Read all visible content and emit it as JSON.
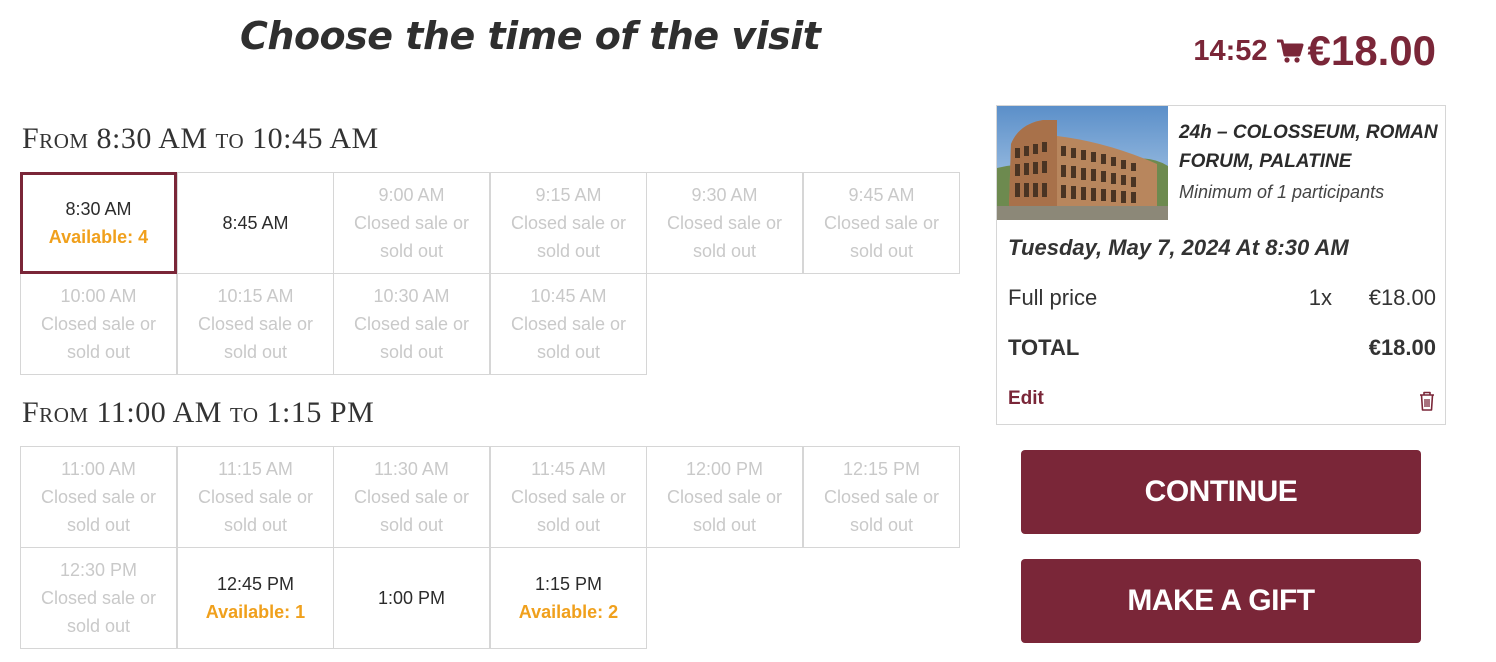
{
  "page_title": "Choose the time of the visit",
  "colors": {
    "accent": "#7a2638",
    "available": "#f0a01c",
    "closed": "#c9c9c9",
    "border": "#d6d6d6"
  },
  "header": {
    "timer": "14:52",
    "cart_icon": "shopping-cart-icon",
    "cart_total": "€18.00"
  },
  "sections": [
    {
      "title": "From 8:30 AM to 10:45 AM",
      "slots": [
        {
          "time": "8:30 AM",
          "status": "Available: 4",
          "state": "selected"
        },
        {
          "time": "8:45 AM",
          "status": "",
          "state": "open"
        },
        {
          "time": "9:00 AM",
          "status": "Closed sale or sold out",
          "state": "closed"
        },
        {
          "time": "9:15 AM",
          "status": "Closed sale or sold out",
          "state": "closed"
        },
        {
          "time": "9:30 AM",
          "status": "Closed sale or sold out",
          "state": "closed"
        },
        {
          "time": "9:45 AM",
          "status": "Closed sale or sold out",
          "state": "closed"
        },
        {
          "time": "10:00 AM",
          "status": "Closed sale or sold out",
          "state": "closed"
        },
        {
          "time": "10:15 AM",
          "status": "Closed sale or sold out",
          "state": "closed"
        },
        {
          "time": "10:30 AM",
          "status": "Closed sale or sold out",
          "state": "closed"
        },
        {
          "time": "10:45 AM",
          "status": "Closed sale or sold out",
          "state": "closed"
        }
      ]
    },
    {
      "title": "From 11:00 AM to 1:15 PM",
      "slots": [
        {
          "time": "11:00 AM",
          "status": "Closed sale or sold out",
          "state": "closed"
        },
        {
          "time": "11:15 AM",
          "status": "Closed sale or sold out",
          "state": "closed"
        },
        {
          "time": "11:30 AM",
          "status": "Closed sale or sold out",
          "state": "closed"
        },
        {
          "time": "11:45 AM",
          "status": "Closed sale or sold out",
          "state": "closed"
        },
        {
          "time": "12:00 PM",
          "status": "Closed sale or sold out",
          "state": "closed"
        },
        {
          "time": "12:15 PM",
          "status": "Closed sale or sold out",
          "state": "closed"
        },
        {
          "time": "12:30 PM",
          "status": "Closed sale or sold out",
          "state": "closed"
        },
        {
          "time": "12:45 PM",
          "status": "Available: 1",
          "state": "available"
        },
        {
          "time": "1:00 PM",
          "status": "",
          "state": "open"
        },
        {
          "time": "1:15 PM",
          "status": "Available: 2",
          "state": "available"
        }
      ]
    }
  ],
  "summary": {
    "product_name": "24h – COLOSSEUM, ROMAN FORUM, PALATINE",
    "minimum": "Minimum of 1 participants",
    "date": "Tuesday, May 7, 2024 At 8:30 AM",
    "line_label": "Full price",
    "line_qty": "1x",
    "line_amount": "€18.00",
    "total_label": "TOTAL",
    "total_amount": "€18.00",
    "edit_label": "Edit",
    "trash_icon": "trash-icon"
  },
  "buttons": {
    "continue": "CONTINUE",
    "gift": "MAKE A GIFT"
  }
}
